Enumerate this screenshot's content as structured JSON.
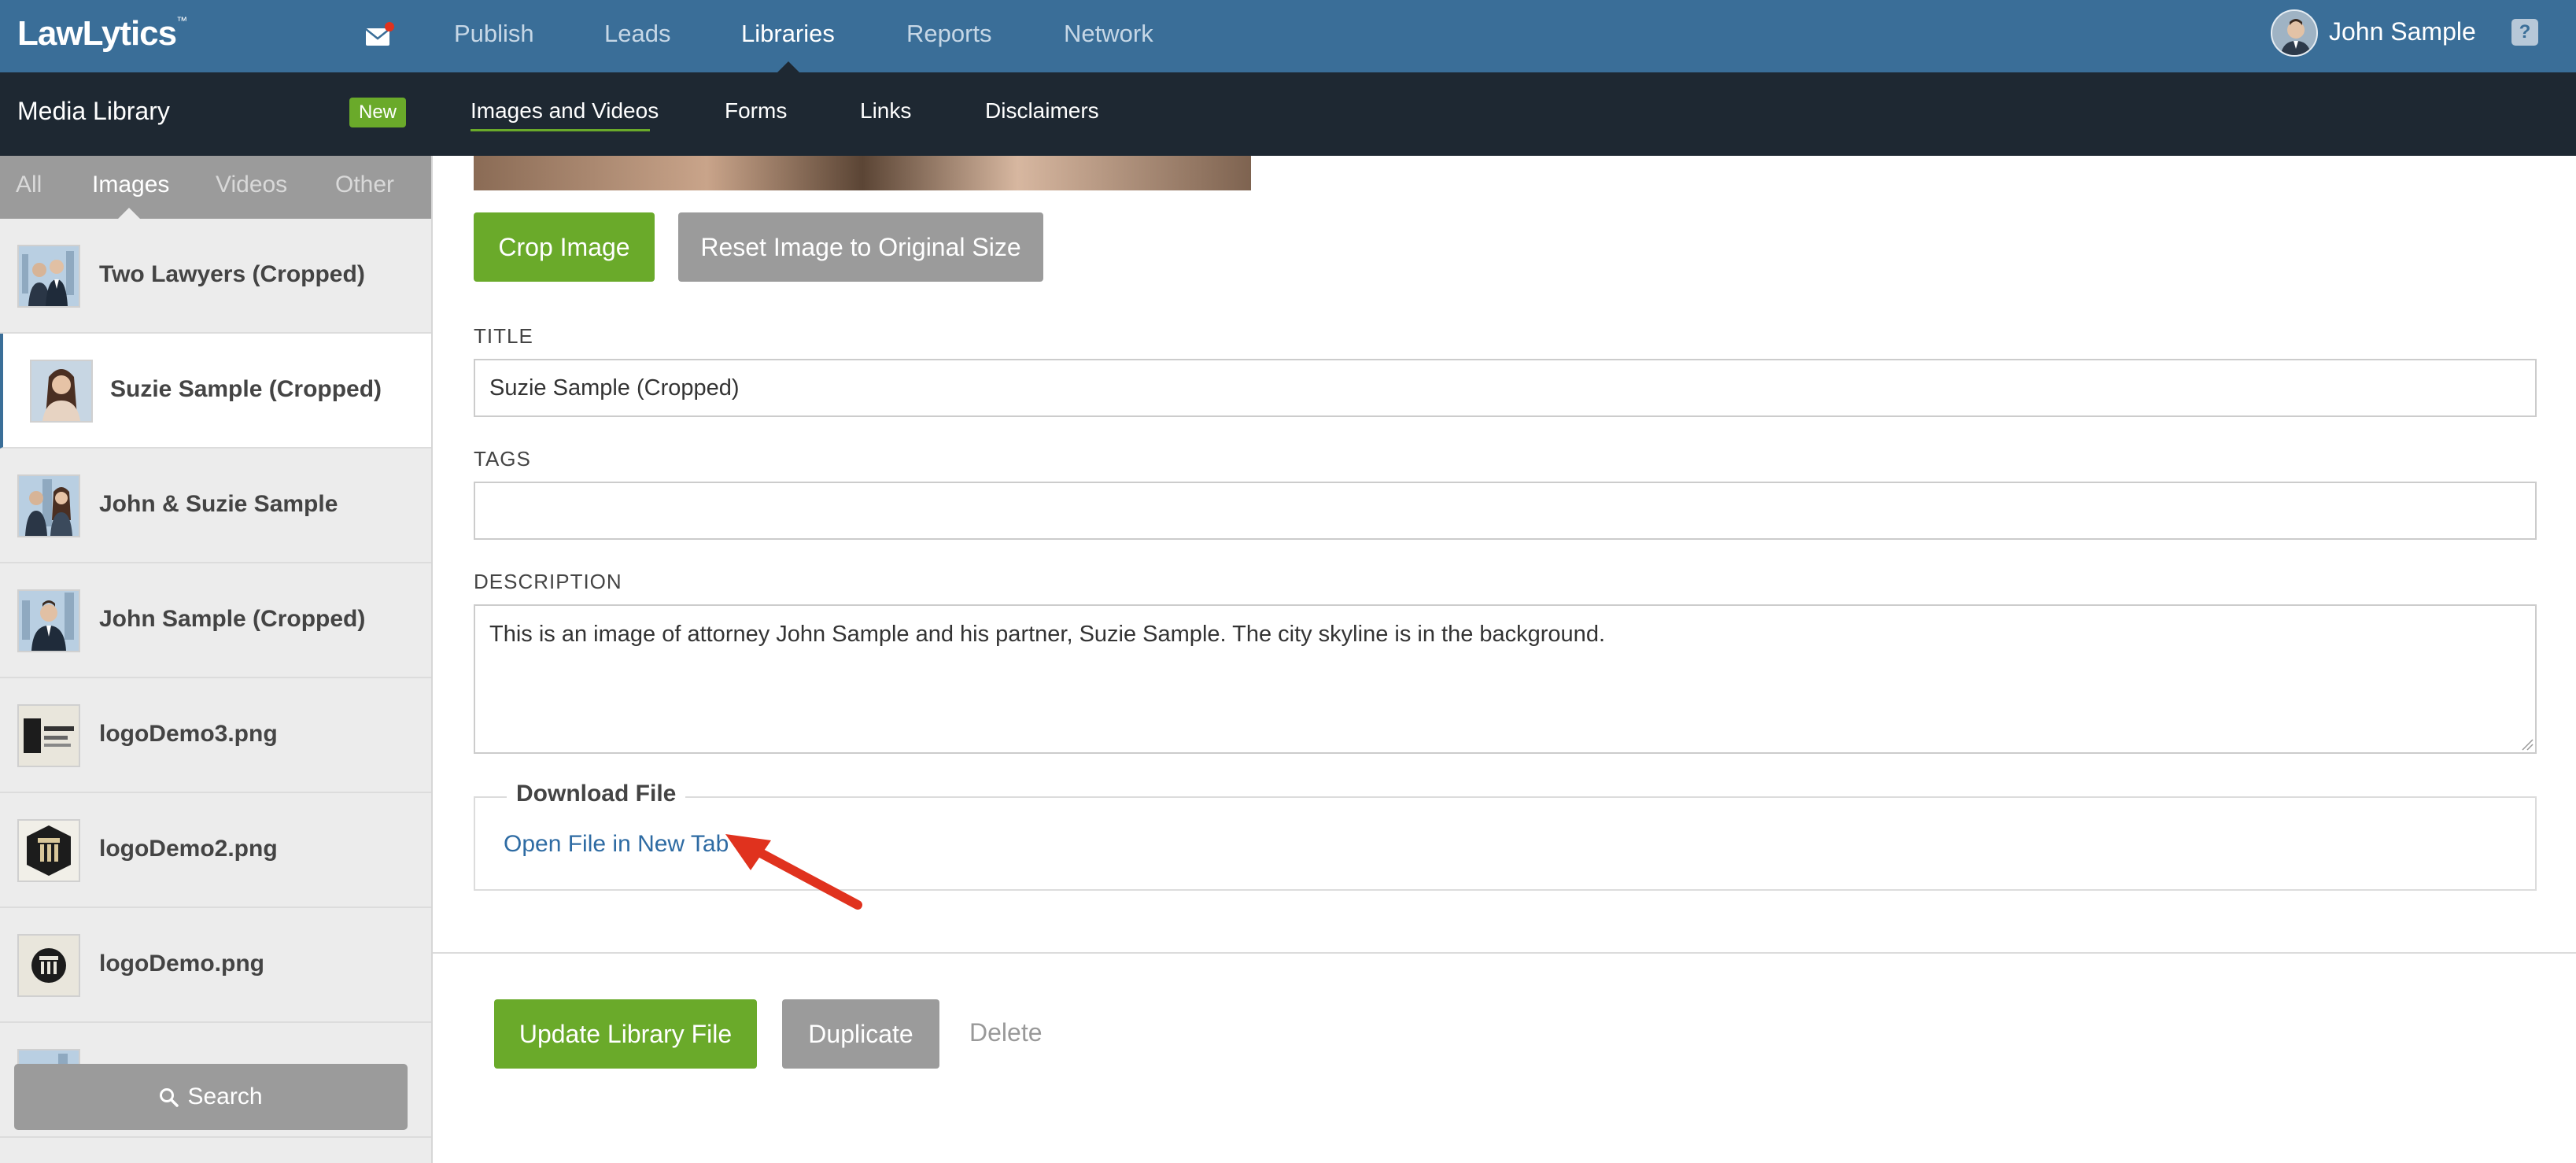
{
  "topbar": {
    "logo": "LawLytics",
    "logo_mark": "™",
    "nav": [
      {
        "label": "Publish"
      },
      {
        "label": "Leads"
      },
      {
        "label": "Libraries"
      },
      {
        "label": "Reports"
      },
      {
        "label": "Network"
      }
    ],
    "active_nav": "Libraries",
    "user_name": "John Sample",
    "help_label": "?"
  },
  "subbar": {
    "title": "Media Library",
    "badge": "New",
    "tabs": [
      {
        "label": "Images and Videos"
      },
      {
        "label": "Forms"
      },
      {
        "label": "Links"
      },
      {
        "label": "Disclaimers"
      }
    ],
    "active_tab": "Images and Videos"
  },
  "sidebar": {
    "filters": [
      {
        "label": "All"
      },
      {
        "label": "Images"
      },
      {
        "label": "Videos"
      },
      {
        "label": "Other"
      }
    ],
    "active_filter": "Images",
    "files": [
      {
        "label": "Two Lawyers (Cropped)",
        "thumb": "two-lawyers"
      },
      {
        "label": "Suzie Sample (Cropped)",
        "thumb": "suzie"
      },
      {
        "label": "John & Suzie Sample",
        "thumb": "two-lawyers"
      },
      {
        "label": "John Sample (Cropped)",
        "thumb": "john"
      },
      {
        "label": "logoDemo3.png",
        "thumb": "logo3"
      },
      {
        "label": "logoDemo2.png",
        "thumb": "logo2"
      },
      {
        "label": "logoDemo.png",
        "thumb": "logo1"
      }
    ],
    "active_file": "Suzie Sample (Cropped)",
    "search_label": "Search"
  },
  "editor": {
    "crop_button": "Crop Image",
    "reset_button": "Reset Image to Original Size",
    "title_label": "TITLE",
    "title_value": "Suzie Sample (Cropped)",
    "tags_label": "TAGS",
    "tags_value": "",
    "description_label": "DESCRIPTION",
    "description_value": "This is an image of attorney John Sample and his partner, Suzie Sample. The city skyline is in the background.",
    "download_legend": "Download File",
    "download_link": "Open File in New Tab",
    "update_button": "Update Library File",
    "duplicate_button": "Duplicate",
    "delete_link": "Delete"
  },
  "colors": {
    "topbar": "#3a6e98",
    "subbar": "#1e2832",
    "accent_green": "#6aaa2a",
    "gray_button": "#9b9b9b",
    "link": "#2e6ba3",
    "annotation_arrow": "#e0321e"
  }
}
